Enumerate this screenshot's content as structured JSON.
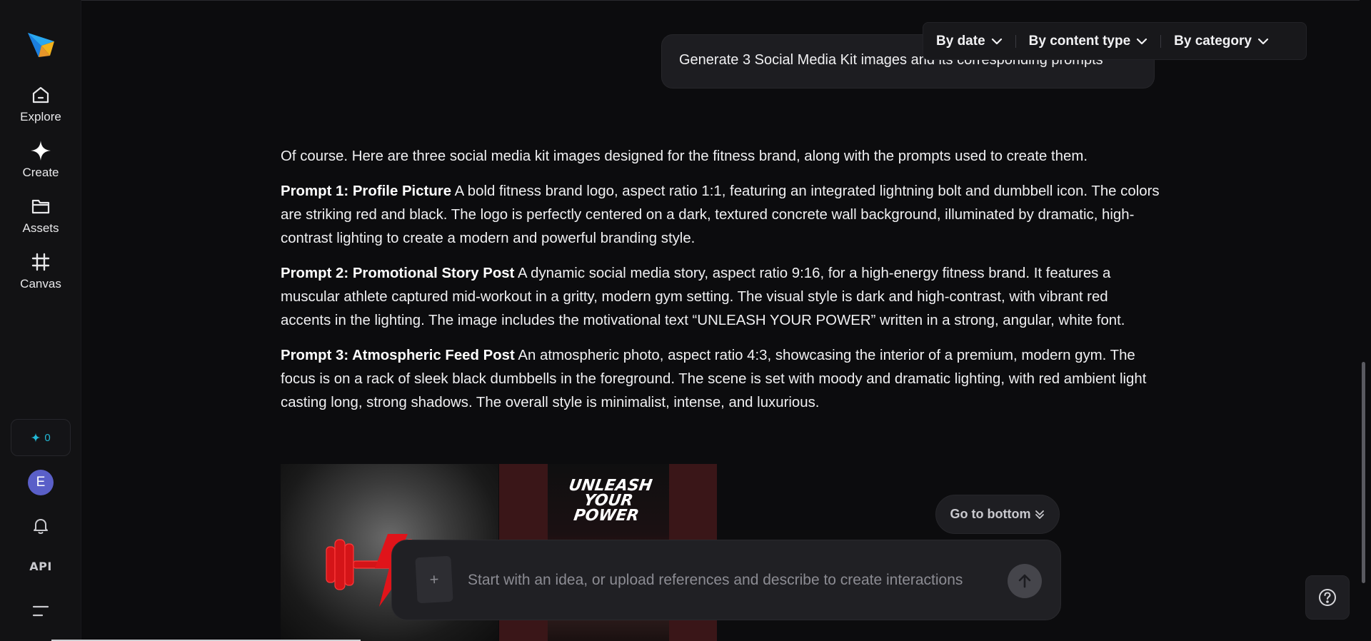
{
  "sidebar": {
    "nav": [
      {
        "label": "Explore",
        "icon": "home-icon"
      },
      {
        "label": "Create",
        "icon": "sparkle-icon"
      },
      {
        "label": "Assets",
        "icon": "folder-icon"
      },
      {
        "label": "Canvas",
        "icon": "canvas-grid-icon"
      }
    ],
    "credits": {
      "icon": "sparkle-icon",
      "count": "0"
    },
    "avatar_initial": "E",
    "api_label": "API"
  },
  "filters": [
    {
      "label": "By date"
    },
    {
      "label": "By content type"
    },
    {
      "label": "By category"
    }
  ],
  "chat": {
    "user_message": "Generate 3 Social Media Kit images and its corresponding prompts",
    "intro": "Of course. Here are three social media kit images designed for the fitness brand, along with the prompts used to create them.",
    "prompts": [
      {
        "title": "Prompt 1: Profile Picture",
        "text": "A bold fitness brand logo, aspect ratio 1:1, featuring an integrated lightning bolt and dumbbell icon. The colors are striking red and black. The logo is perfectly centered on a dark, textured concrete wall background, illuminated by dramatic, high-contrast lighting to create a modern and powerful branding style."
      },
      {
        "title": "Prompt 2: Promotional Story Post",
        "text": "A dynamic social media story, aspect ratio 9:16, for a high-energy fitness brand. It features a muscular athlete captured mid-workout in a gritty, modern gym setting. The visual style is dark and high-contrast, with vibrant red accents in the lighting. The image includes the motivational text “UNLEASH YOUR POWER” written in a strong, angular, white font."
      },
      {
        "title": "Prompt 3: Atmospheric Feed Post",
        "text": "An atmospheric photo, aspect ratio 4:3, showcasing the interior of a premium, modern gym. The focus is on a rack of sleek black dumbbells in the foreground. The scene is set with moody and dramatic lighting, with red ambient light casting long, strong shadows. The overall style is minimalist, intense, and luxurious."
      }
    ],
    "images": {
      "story_text_lines": [
        "UNLEASH",
        "YOUR",
        "POWER"
      ]
    }
  },
  "go_to_bottom": "Go to bottom",
  "composer": {
    "placeholder": "Start with an idea, or upload references and describe to create interactions",
    "upload_symbol": "+"
  },
  "colors": {
    "background": "#0c0c0e",
    "accent_cyan": "#22b8d6",
    "avatar": "#5a5fc8",
    "brand_red": "#e0141a"
  }
}
